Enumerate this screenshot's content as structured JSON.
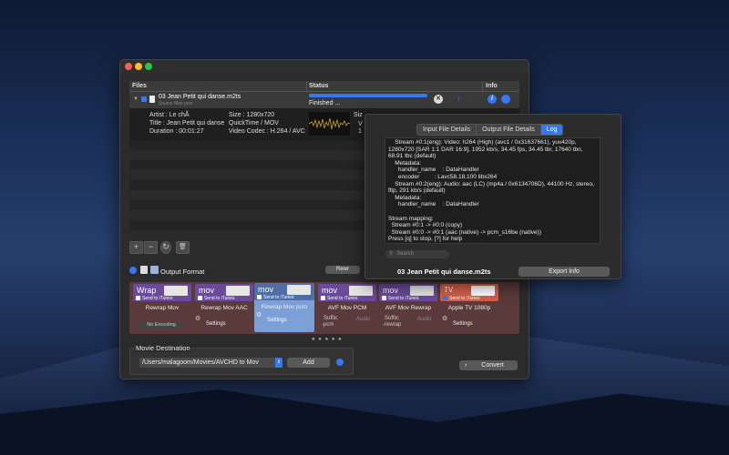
{
  "window": {
    "columns": {
      "files": "Files",
      "status": "Status",
      "info": "Info"
    },
    "file": {
      "name": "03 Jean Petit qui danse.m2ts",
      "sub": "Source Mov pcm",
      "status": "Finished ...",
      "progress": 1.0,
      "artist": "Artist : Le chÃ",
      "title": "Title : Jean Petit qui danse",
      "duration": "Duration : 00:01:27",
      "size": "Size : 1280x720",
      "container": "QuickTime / MOV",
      "video_codec": "Video Codec : H.264 / AVC",
      "size_partial": "Siz",
      "v_partial": "V",
      "one_partial": "1"
    },
    "tools": {
      "add": "+",
      "remove": "−",
      "refresh": "↻",
      "trash": "🗑"
    },
    "output_format_label": "Output Format",
    "rewrap_button": "Rewr",
    "formats": [
      {
        "tag": "Wrap",
        "itunes": "Send to iTunes",
        "label": "Rewrap Mov",
        "extra": "No Encoding",
        "color": "#6a4a9a"
      },
      {
        "tag": "mov",
        "itunes": "Send to iTunes",
        "label": "Rewrap Mov AAC",
        "extra": "Settings",
        "color": "#6a4a9a"
      },
      {
        "tag": "mov",
        "itunes": "Send to iTunes",
        "label": "Rewrap Mov pcm",
        "extra": "Settings",
        "color": "#7b9fd6"
      },
      {
        "tag": "mov",
        "itunes": "Send to iTunes",
        "label": "AVF Mov PCM",
        "suffix_label": "Suffix:",
        "suffix": "-pcm",
        "audio": "Audio",
        "color": "#6a4a9a"
      },
      {
        "tag": "mov",
        "itunes": "Send to iTunes",
        "label": "AVF Mov Rewrap",
        "suffix_label": "Suffix:",
        "suffix": "-rewrap",
        "audio": "Audio",
        "color": "#6a4a9a"
      },
      {
        "tag": "TV",
        "itunes": "Send to iTunes",
        "label": "Apple TV 1080p",
        "extra": "Settings",
        "color": "#d0604a"
      }
    ],
    "movie_destination_label": "Movie Destination",
    "destination_path": "/Users/malagoom/Movies/AVCHD to Mov",
    "add_button": "Add",
    "convert_button": "Convert"
  },
  "panel": {
    "tabs": [
      "Input File Details",
      "Output File Details",
      "Log"
    ],
    "active_tab": "Log",
    "log_lines": [
      "    Stream #0:1(eng): Video: h264 (High) (avc1 / 0x31637661), yuv420p,",
      "1280x720 [SAR 1:1 DAR 16:9], 1952 kb/s, 34.45 fps, 34.45 tbr, 17640 tbn,",
      "68.91 tbc (default)",
      "    Metadata:",
      "      handler_name    : DataHandler",
      "      encoder         : Lavc58.18.100 libx264",
      "    Stream #0:2(eng): Audio: aac (LC) (mp4a / 0x6134706D), 44100 Hz, stereo,",
      "fltp, 291 kb/s (default)",
      "    Metadata:",
      "      handler_name    : DataHandler",
      "",
      "Stream mapping:",
      "  Stream #0:1 -> #0:0 (copy)",
      "  Stream #0:0 -> #0:1 (aac (native) -> pcm_s16be (native))",
      "Press [q] to stop, [?] for help"
    ],
    "search_placeholder": "Search",
    "file_name": "03 Jean Petit qui danse.m2ts",
    "export_button": "Export Info"
  }
}
